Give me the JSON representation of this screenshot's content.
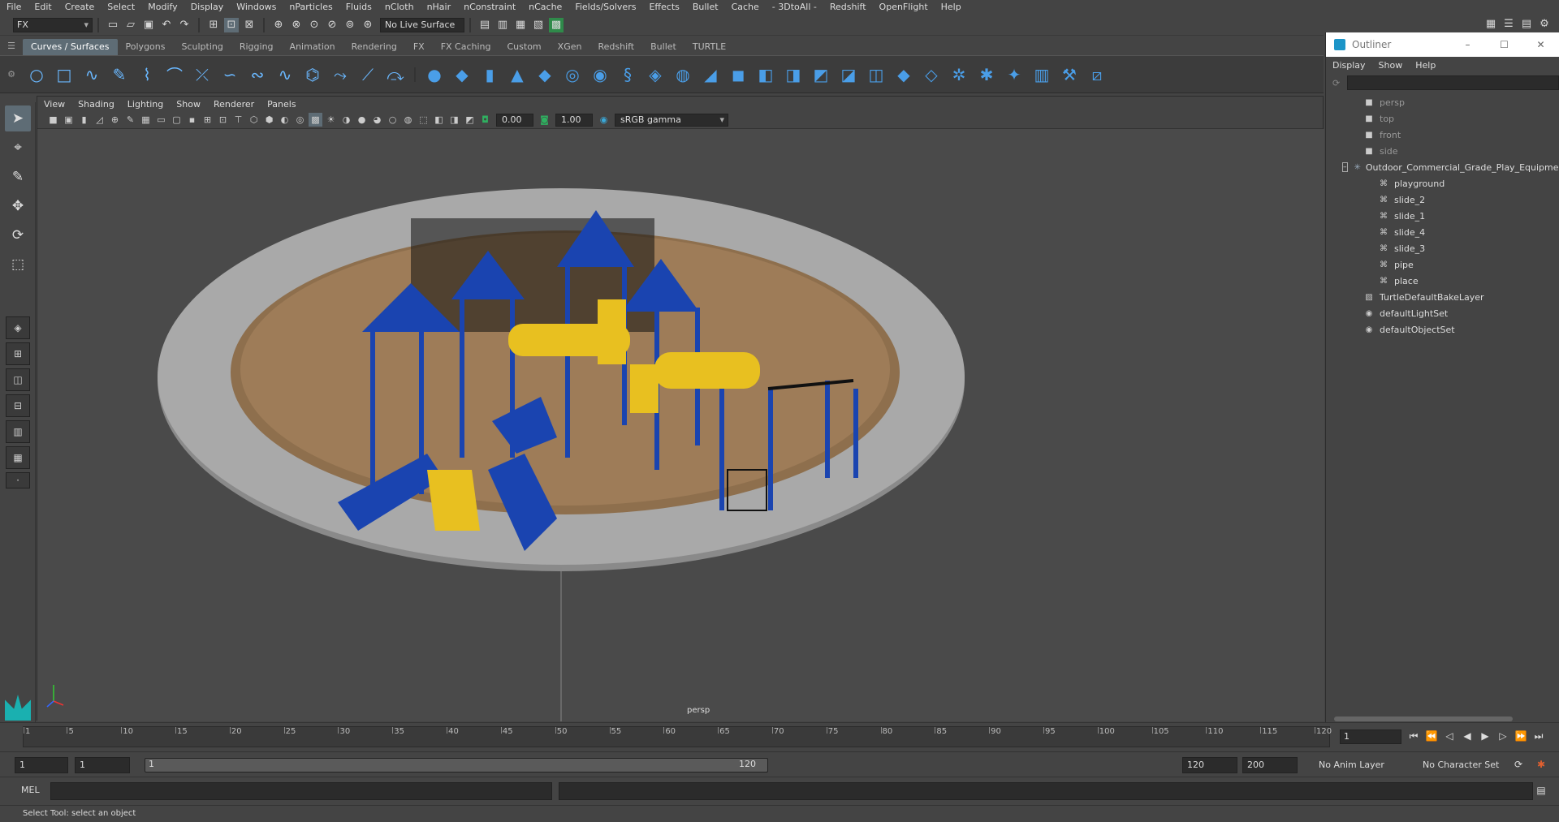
{
  "menubar": [
    "File",
    "Edit",
    "Create",
    "Select",
    "Modify",
    "Display",
    "Windows",
    "nParticles",
    "Fluids",
    "nCloth",
    "nHair",
    "nConstraint",
    "nCache",
    "Fields/Solvers",
    "Effects",
    "Bullet",
    "Cache",
    "- 3DtoAll -",
    "Redshift",
    "OpenFlight",
    "Help"
  ],
  "status": {
    "mode": "FX",
    "live_surface": "No Live Surface"
  },
  "shelf_tabs": [
    "Curves / Surfaces",
    "Polygons",
    "Sculpting",
    "Rigging",
    "Animation",
    "Rendering",
    "FX",
    "FX Caching",
    "Custom",
    "XGen",
    "Redshift",
    "Bullet",
    "TURTLE"
  ],
  "viewport": {
    "menu": [
      "View",
      "Shading",
      "Lighting",
      "Show",
      "Renderer",
      "Panels"
    ],
    "exposure": "0.00",
    "gamma": "1.00",
    "color_space": "sRGB gamma",
    "camera": "persp"
  },
  "outliner": {
    "title": "Outliner",
    "menu": [
      "Display",
      "Show",
      "Help"
    ],
    "cameras": [
      "persp",
      "top",
      "front",
      "side"
    ],
    "group": "Outdoor_Commercial_Grade_Play_Equipment",
    "children": [
      "playground",
      "slide_2",
      "slide_1",
      "slide_4",
      "slide_3",
      "pipe",
      "place"
    ],
    "sets": [
      "TurtleDefaultBakeLayer",
      "defaultLightSet",
      "defaultObjectSet"
    ]
  },
  "timeline": {
    "ticks": [
      "1",
      "5",
      "10",
      "15",
      "20",
      "25",
      "30",
      "35",
      "40",
      "45",
      "50",
      "55",
      "60",
      "65",
      "70",
      "75",
      "80",
      "85",
      "90",
      "95",
      "100",
      "105",
      "110",
      "115",
      "120"
    ],
    "current_frame": "1"
  },
  "range": {
    "start": "1",
    "playback_start": "1",
    "slider_start": "1",
    "slider_end": "120",
    "playback_end": "120",
    "end": "200",
    "anim_layer": "No Anim Layer",
    "character_set": "No Character Set"
  },
  "command_line": {
    "lang": "MEL"
  },
  "help_line": "Select Tool: select an object",
  "colors": {
    "accent": "#5e6c75",
    "play_blue": "#1a44b0",
    "play_yellow": "#e8c020",
    "ground": "#9a7a55",
    "border_ring": "#a7a7a7"
  }
}
